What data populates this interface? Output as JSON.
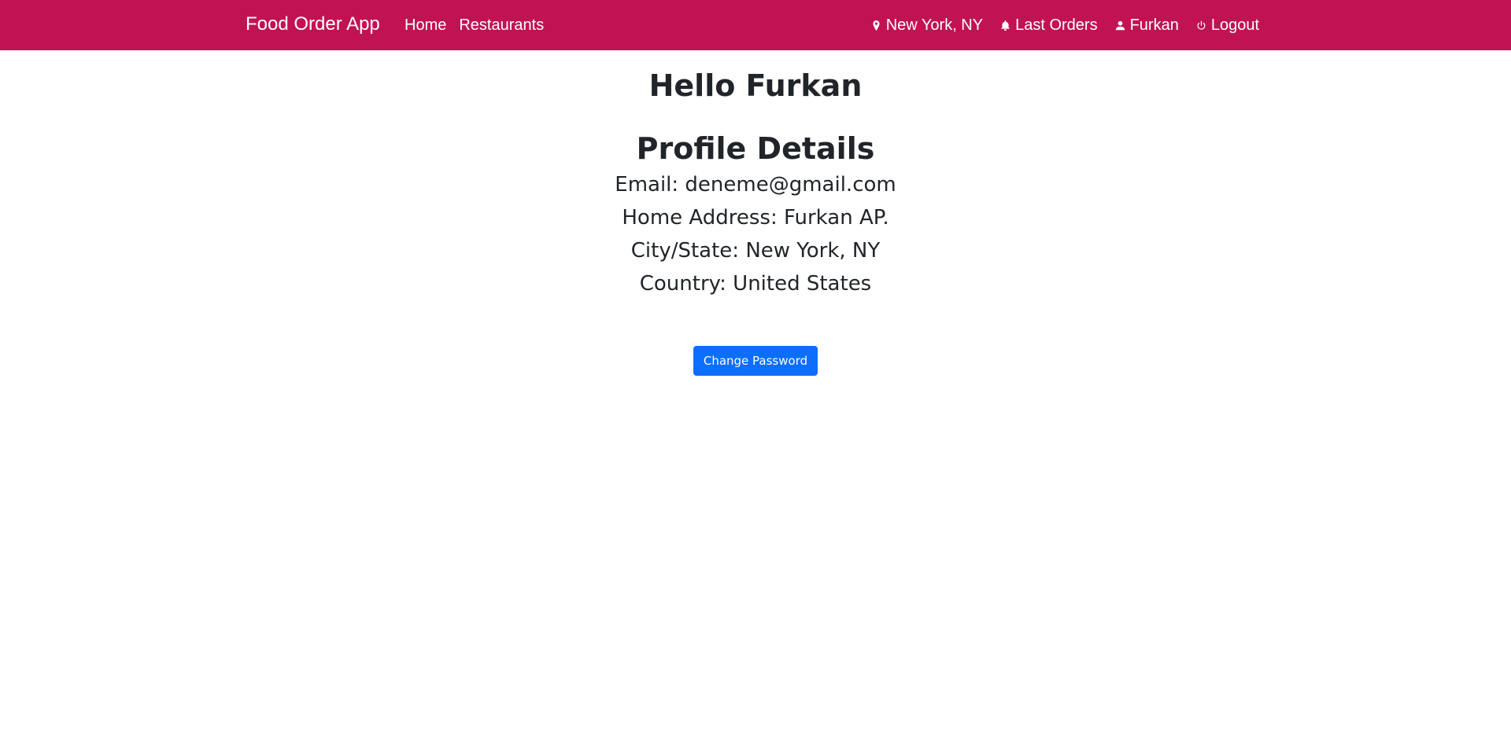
{
  "navbar": {
    "brand": "Food Order App",
    "left_links": [
      {
        "label": "Home"
      },
      {
        "label": "Restaurants"
      }
    ],
    "right_links": [
      {
        "label": "New York, NY",
        "icon": "location-pin-icon"
      },
      {
        "label": "Last Orders",
        "icon": "bell-icon"
      },
      {
        "label": "Furkan",
        "icon": "user-icon"
      },
      {
        "label": "Logout",
        "icon": "power-icon"
      }
    ],
    "background_color": "#c11354"
  },
  "main": {
    "greeting": "Hello Furkan",
    "section_title": "Profile Details",
    "details": {
      "email": "Email: deneme@gmail.com",
      "home_address": "Home Address: Furkan AP.",
      "city_state": "City/State: New York, NY",
      "country": "Country: United States"
    },
    "change_password_label": "Change Password",
    "button_color": "#0d6efd"
  }
}
